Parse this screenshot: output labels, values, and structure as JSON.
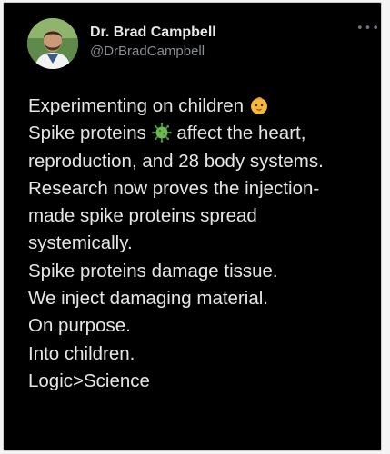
{
  "tweet": {
    "author_name": "Dr. Brad Campbell",
    "author_handle": "@DrBradCampbell",
    "more_icon": "more-horizontal-icon",
    "lines": [
      {
        "text": "Experimenting on children",
        "emoji": "baby-face-icon"
      },
      {
        "text": "Spike proteins",
        "emoji": "virus-icon",
        "after": "affect the heart,"
      },
      {
        "text": "reproduction, and 28 body systems."
      },
      {
        "text": "Research now proves the injection-"
      },
      {
        "text": "made spike proteins spread"
      },
      {
        "text": "systemically."
      },
      {
        "text": "Spike proteins damage tissue."
      },
      {
        "text": "We inject damaging material."
      },
      {
        "text": "On purpose."
      },
      {
        "text": "Into children."
      },
      {
        "text": "Logic>Science"
      }
    ]
  },
  "colors": {
    "background": "#000000",
    "text": "#e6e6e6",
    "handle": "#8a8d91"
  }
}
